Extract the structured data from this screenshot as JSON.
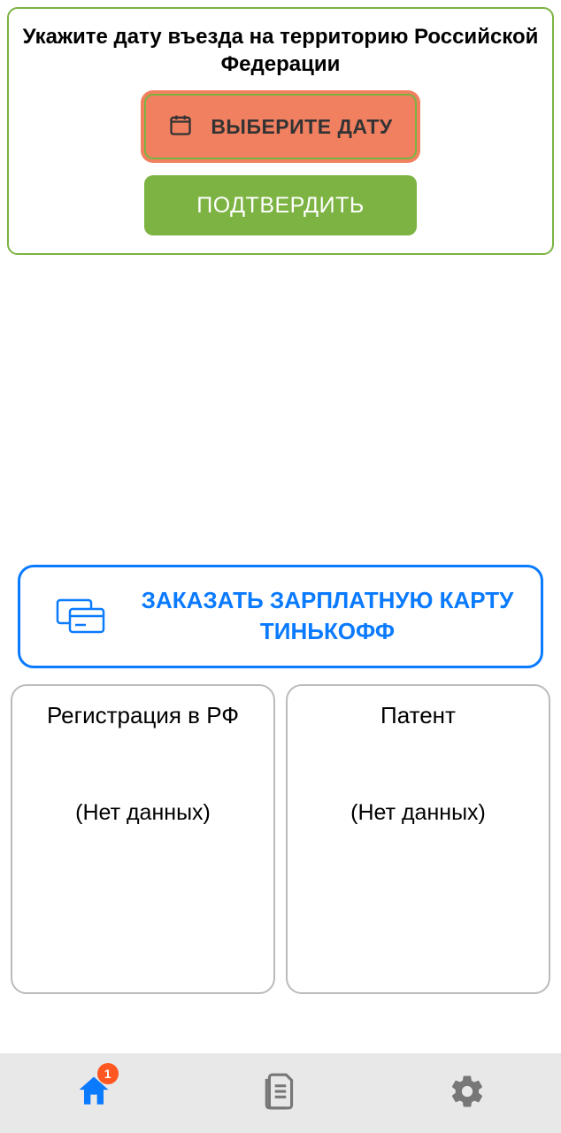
{
  "entryCard": {
    "title": "Укажите дату въезда на территорию Российской Федерации",
    "dateButtonLabel": "ВЫБЕРИТЕ ДАТУ",
    "confirmButtonLabel": "ПОДТВЕРДИТЬ"
  },
  "orderCard": {
    "text": "ЗАКАЗАТЬ ЗАРПЛАТНУЮ КАРТУ ТИНЬКОФФ"
  },
  "infoCards": {
    "registration": {
      "title": "Регистрация в РФ",
      "value": "(Нет данных)"
    },
    "patent": {
      "title": "Патент",
      "value": "(Нет данных)"
    }
  },
  "bottomNav": {
    "homeBadge": "1"
  },
  "colors": {
    "accentGreen": "#7cb342",
    "accentBlue": "#0a7aff",
    "highlightOrange": "#f08060",
    "badgeRed": "#ff5722"
  }
}
